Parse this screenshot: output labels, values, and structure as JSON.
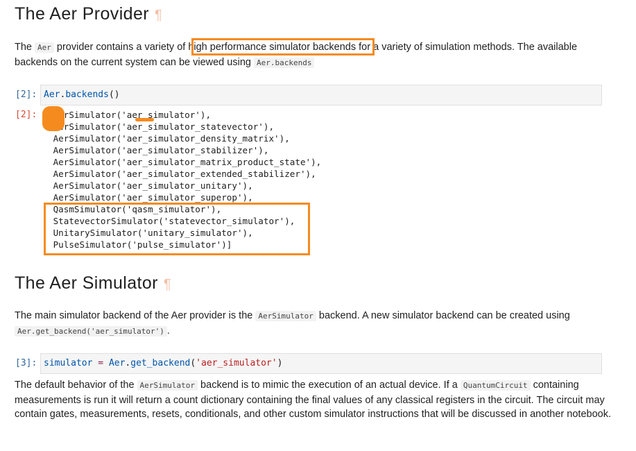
{
  "section1": {
    "title": "The Aer Provider",
    "pilcrow": "¶",
    "para": {
      "t1": "The ",
      "code1": "Aer",
      "t2": " provider contains a variety of ",
      "highlight": "high performance simulator backends",
      "t3": " for a variety of simulation methods. The available backends on the current system can be viewed using ",
      "code2": "Aer.backends"
    }
  },
  "cell2": {
    "in_prompt": "[2]:",
    "in_obj": "Aer",
    "in_dot": ".",
    "in_func": "backends",
    "in_paren": "()",
    "out_prompt": "[2]:",
    "output_lines": [
      "[AerSimulator('aer_simulator'),",
      " AerSimulator('aer_simulator_statevector'),",
      " AerSimulator('aer_simulator_density_matrix'),",
      " AerSimulator('aer_simulator_stabilizer'),",
      " AerSimulator('aer_simulator_matrix_product_state'),",
      " AerSimulator('aer_simulator_extended_stabilizer'),",
      " AerSimulator('aer_simulator_unitary'),",
      " AerSimulator('aer_simulator_superop'),",
      " QasmSimulator('qasm_simulator'),",
      " StatevectorSimulator('statevector_simulator'),",
      " UnitarySimulator('unitary_simulator'),",
      " PulseSimulator('pulse_simulator')]"
    ]
  },
  "section2": {
    "title": "The Aer Simulator",
    "pilcrow": "¶",
    "para": {
      "t1": "The main simulator backend of the Aer provider is the ",
      "code1": "AerSimulator",
      "t2": " backend. A new simulator backend can be created using ",
      "code2": "Aer.get_backend('aer_simulator')",
      "t3": "."
    }
  },
  "cell3": {
    "in_prompt": "[3]:",
    "var": "simulator",
    "eq": " = ",
    "obj": "Aer",
    "dot": ".",
    "func": "get_backend",
    "open": "(",
    "arg": "'aer_simulator'",
    "close": ")"
  },
  "para3": {
    "t1": "The default behavior of the ",
    "code1": "AerSimulator",
    "t2": " backend is to mimic the execution of an actual device. If a ",
    "code2": "QuantumCircuit",
    "t3": " containing measurements is run it will return a count dictionary containing the final values of any classical registers in the circuit. The circuit may contain gates, measurements, resets, conditionals, and other custom simulator instructions that will be discussed in another notebook."
  },
  "colors": {
    "annotation": "#f58b1f",
    "prompt_in": "#30669b",
    "prompt_out": "#d84a33"
  }
}
